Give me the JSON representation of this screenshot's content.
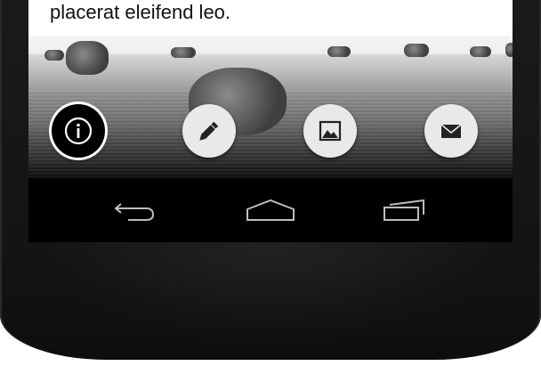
{
  "content": {
    "body_text": "placerat eleifend leo."
  },
  "actions": [
    {
      "name": "info",
      "icon": "info-icon",
      "selected": true
    },
    {
      "name": "edit",
      "icon": "pencil-icon",
      "selected": false
    },
    {
      "name": "image",
      "icon": "image-icon",
      "selected": false
    },
    {
      "name": "email",
      "icon": "envelope-icon",
      "selected": false
    }
  ],
  "navigation": [
    {
      "name": "back",
      "icon": "back-icon"
    },
    {
      "name": "home",
      "icon": "home-icon"
    },
    {
      "name": "recents",
      "icon": "recent-apps-icon"
    }
  ],
  "colors": {
    "button_bg": "#e9e9e9",
    "selected_button_bg": "#000000",
    "nav_icon": "#bdbdbd",
    "phone_body": "#161616"
  }
}
